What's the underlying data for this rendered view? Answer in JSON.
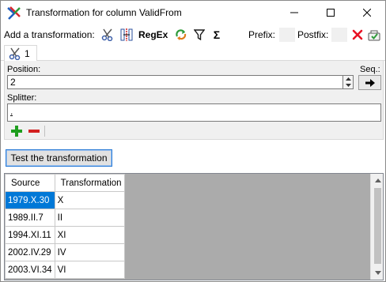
{
  "window": {
    "title": "Transformation for column ValidFrom",
    "controls": [
      "minimize",
      "maximize",
      "close"
    ]
  },
  "toolbar": {
    "add_label": "Add a transformation:",
    "icons": [
      "scissors-icon",
      "split-column-icon",
      "regex",
      "replace-icon",
      "filter-icon",
      "sum-icon"
    ],
    "regex_label": "RegEx",
    "sum_symbol": "Σ",
    "prefix_label": "Prefix:",
    "prefix_value": "",
    "postfix_label": "Postfix:",
    "postfix_value": ""
  },
  "tabs": [
    {
      "label": "1",
      "icon": "scissors-icon",
      "active": true
    }
  ],
  "panel": {
    "position_label": "Position:",
    "position_value": "2",
    "seq_label": "Seq.:",
    "splitter_label": "Splitter:",
    "splitter_value": "."
  },
  "actions": {
    "test_label": "Test the transformation"
  },
  "grid": {
    "columns": [
      "Source",
      "Transformation"
    ],
    "rows": [
      {
        "source": "1979.X.30",
        "transformation": "X",
        "selected": true
      },
      {
        "source": "1989.II.7",
        "transformation": "II",
        "selected": false
      },
      {
        "source": "1994.XI.11",
        "transformation": "XI",
        "selected": false
      },
      {
        "source": "2002.IV.29",
        "transformation": "IV",
        "selected": false
      },
      {
        "source": "2003.VI.34",
        "transformation": "VI",
        "selected": false
      }
    ]
  },
  "colors": {
    "selection": "#0078d7",
    "button_focus": "#2b7bd6",
    "close_red": "#e81123",
    "plus_green": "#1e9e1e",
    "minus_red": "#d32020"
  }
}
